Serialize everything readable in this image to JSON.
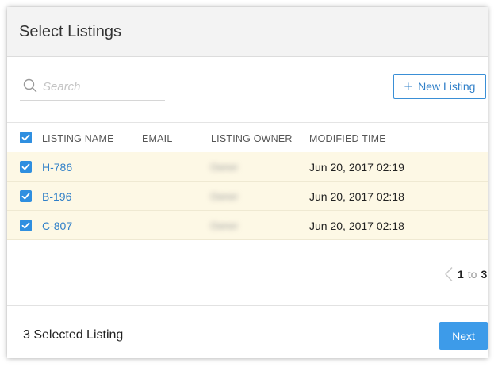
{
  "dialog": {
    "title": "Select Listings"
  },
  "search": {
    "placeholder": "Search",
    "value": ""
  },
  "toolbar": {
    "new_listing_label": "New Listing"
  },
  "table": {
    "columns": [
      "LISTING NAME",
      "EMAIL",
      "LISTING OWNER",
      "MODIFIED TIME"
    ],
    "rows": [
      {
        "name": "H-786",
        "email": "",
        "owner": "Owner",
        "modified": "Jun 20, 2017 02:19",
        "checked": true
      },
      {
        "name": "B-196",
        "email": "",
        "owner": "Owner",
        "modified": "Jun 20, 2017 02:18",
        "checked": true
      },
      {
        "name": "C-807",
        "email": "",
        "owner": "Owner",
        "modified": "Jun 20, 2017 02:18",
        "checked": true
      }
    ],
    "select_all_checked": true
  },
  "pagination": {
    "from": "1",
    "to_label": "to",
    "total": "3"
  },
  "footer": {
    "selected_label": "3 Selected Listing",
    "next_label": "Next"
  },
  "colors": {
    "accent": "#2f8fe0",
    "link": "#2f7fc8",
    "selected_row": "#fdf8e5",
    "header_bg": "#f3f3f3"
  },
  "icons": {
    "search": "search-icon",
    "plus": "plus-icon",
    "check": "check-icon",
    "chevron_left": "chevron-left-icon"
  }
}
